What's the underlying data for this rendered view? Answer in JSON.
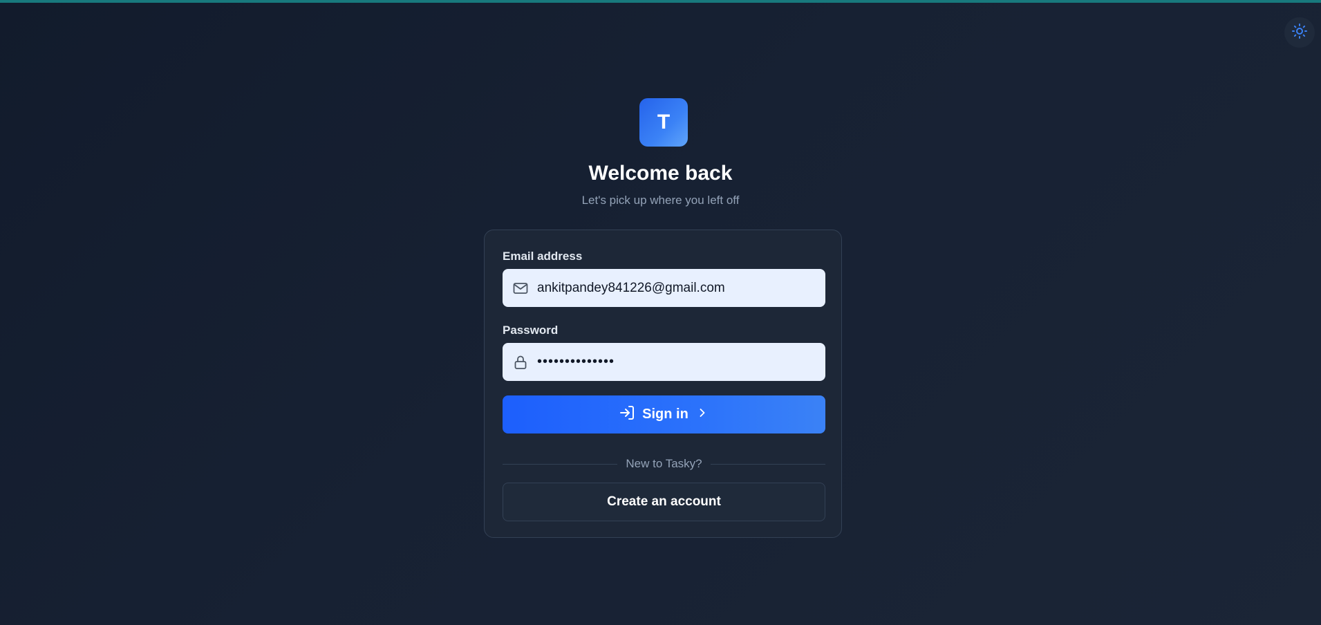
{
  "theme_toggle": {
    "icon": "sun-icon"
  },
  "logo": {
    "letter": "T"
  },
  "header": {
    "title": "Welcome back",
    "subtitle": "Let's pick up where you left off"
  },
  "form": {
    "email": {
      "label": "Email address",
      "value": "ankitpandey841226@gmail.com",
      "icon": "mail-icon"
    },
    "password": {
      "label": "Password",
      "value": "••••••••••••••",
      "icon": "lock-icon"
    },
    "submit": {
      "label": "Sign in",
      "icon": "log-in-icon",
      "trailing_icon": "chevron-right-icon"
    },
    "divider_text": "New to Tasky?",
    "create_account_label": "Create an account"
  },
  "colors": {
    "accent": "#2563eb",
    "top_bar": "#18797d",
    "background": "#172133"
  }
}
